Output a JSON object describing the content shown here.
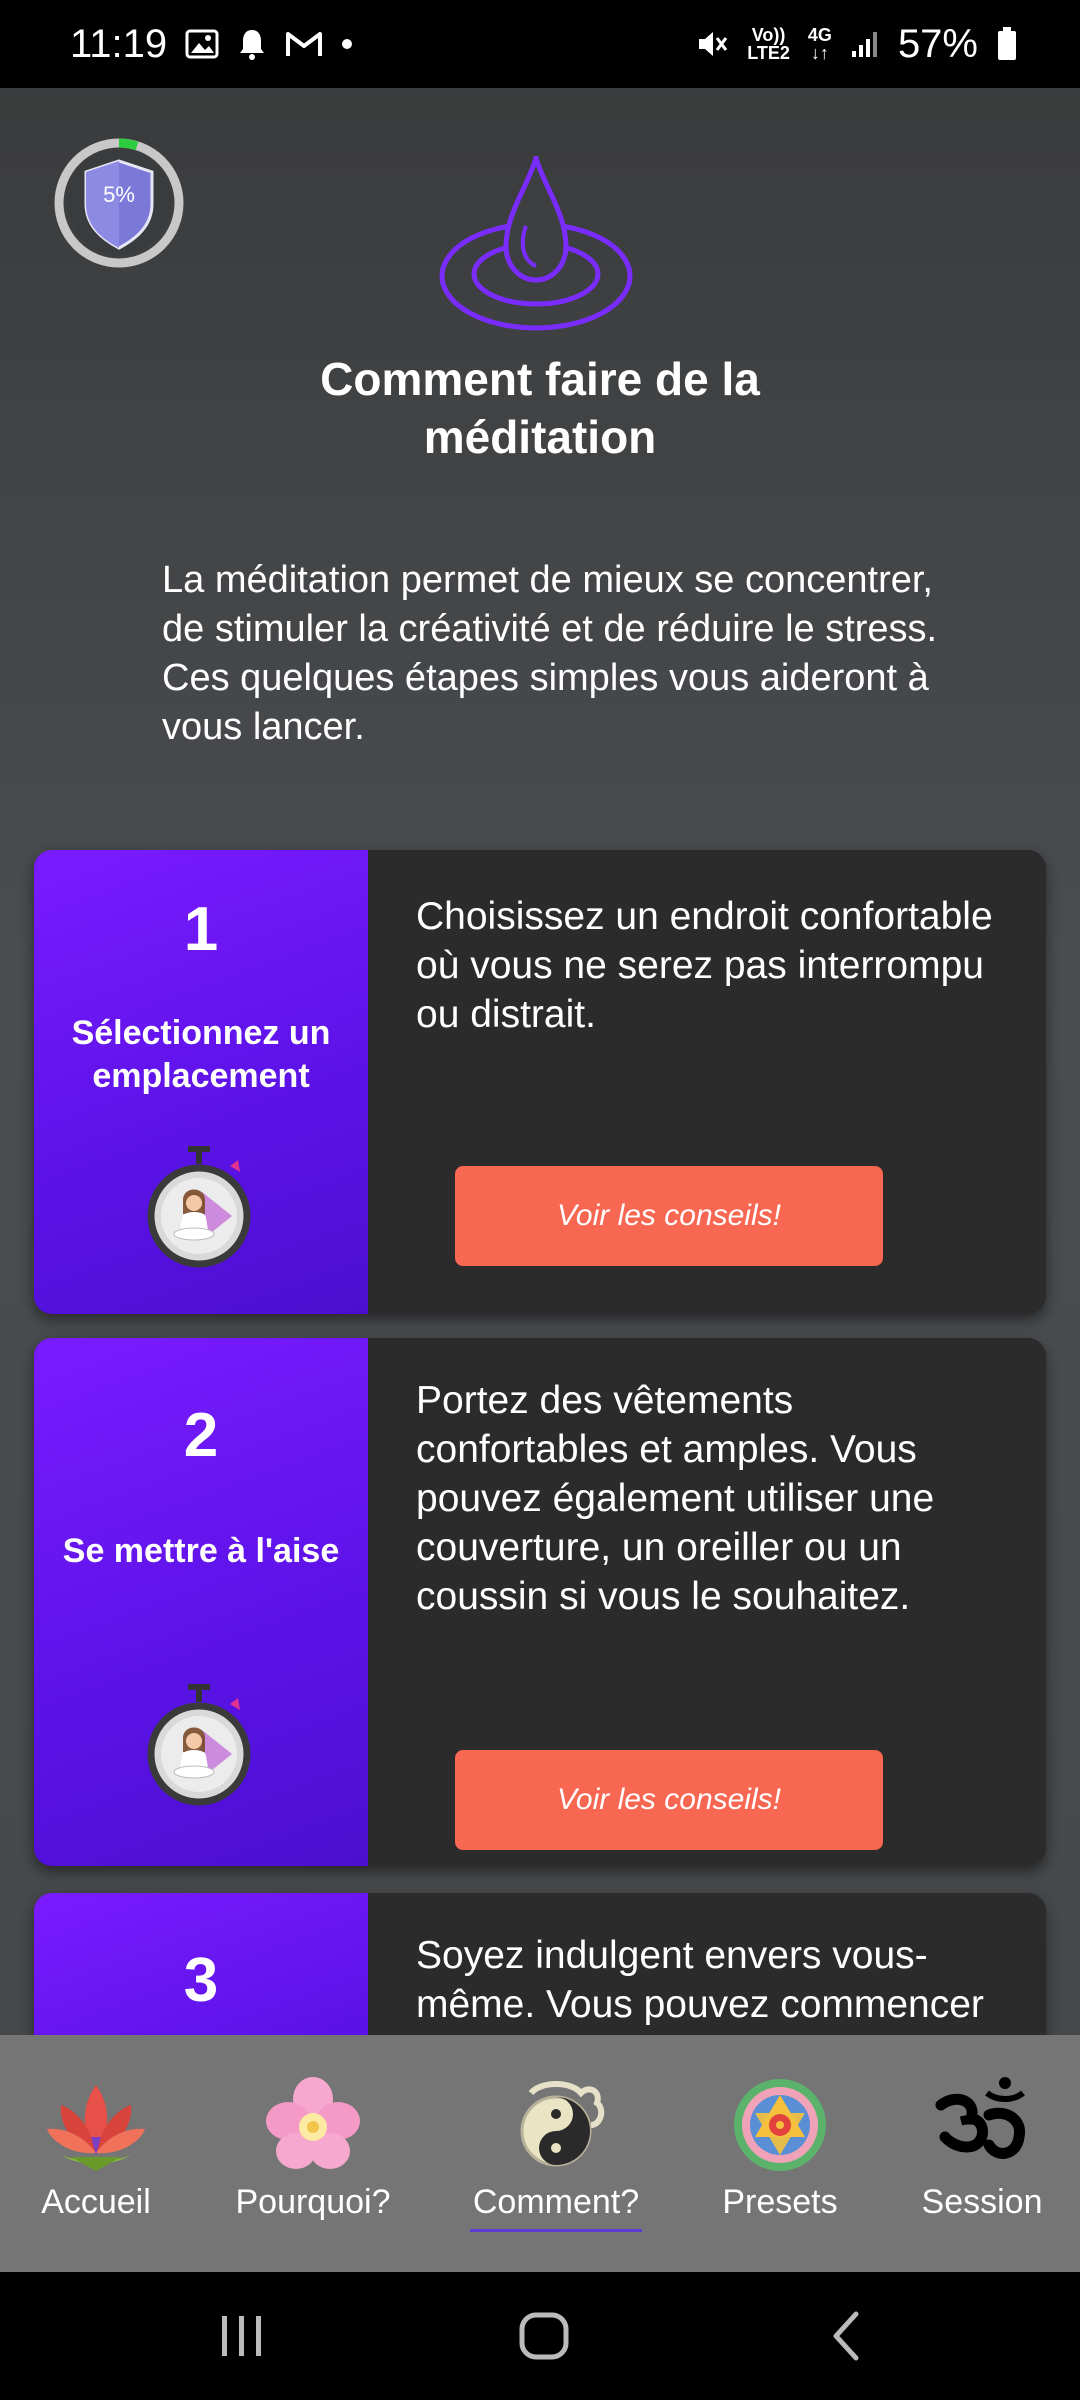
{
  "status_bar": {
    "time": "11:19",
    "volte": "Vo))",
    "lte2": "LTE2",
    "network": "4G",
    "battery": "57%"
  },
  "progress": {
    "label": "5%",
    "value": 0.05
  },
  "page": {
    "title_line1": "Comment faire de la",
    "title_line2": "méditation",
    "intro": "La méditation permet de mieux se concentrer, de stimuler la créativité et de réduire le stress. Ces quelques étapes simples vous aideront à vous lancer."
  },
  "steps": [
    {
      "number": "1",
      "title": "Sélectionnez un emplacement",
      "text": "Choisissez un endroit confortable où vous ne serez pas interrompu ou distrait.",
      "button": "Voir les conseils!"
    },
    {
      "number": "2",
      "title": "Se mettre à l'aise",
      "text": "Portez des vêtements confortables et amples. Vous pouvez également utiliser une couverture, un oreiller ou un coussin si vous le souhaitez.",
      "button": "Voir les conseils!"
    },
    {
      "number": "3",
      "text": "Soyez indulgent envers vous-même. Vous pouvez commencer par une"
    }
  ],
  "nav": [
    {
      "label": "Accueil",
      "icon": "lotus-icon"
    },
    {
      "label": "Pourquoi?",
      "icon": "flower-icon"
    },
    {
      "label": "Comment?",
      "icon": "yin-yang-icon",
      "active": true
    },
    {
      "label": "Presets",
      "icon": "mandala-icon"
    },
    {
      "label": "Session",
      "icon": "om-icon"
    }
  ],
  "colors": {
    "accent_purple": "#7b1bff",
    "button_coral": "#f76751",
    "progress_green": "#2ecc40"
  }
}
